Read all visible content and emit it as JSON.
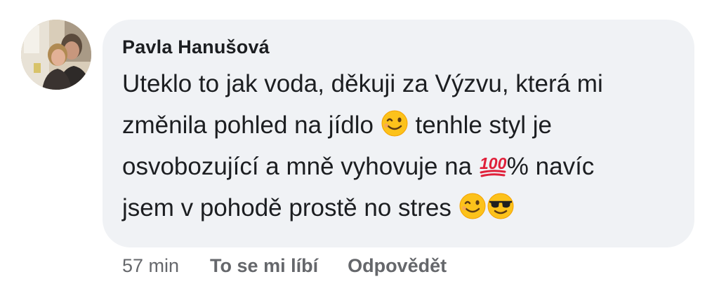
{
  "comment": {
    "author": "Pavla Hanušová",
    "text_segments": {
      "s1": "Uteklo to jak voda, děkuji za Výzvu, která mi",
      "s2": "změnila pohled na jídlo ",
      "s3": " tenhle styl je",
      "s4": "osvobozující a mně vyhovuje na ",
      "s5": "% navíc",
      "s6": "jsem v pohodě prostě no stres "
    },
    "emojis": [
      "winking-face",
      "hundred-points",
      "winking-face",
      "smiling-face-with-sunglasses"
    ]
  },
  "actions": {
    "time": "57 min",
    "like_label": "To se mi líbí",
    "reply_label": "Odpovědět"
  },
  "colors": {
    "bubble_bg": "#f0f2f5",
    "text": "#1c1e21",
    "meta": "#65676b"
  }
}
